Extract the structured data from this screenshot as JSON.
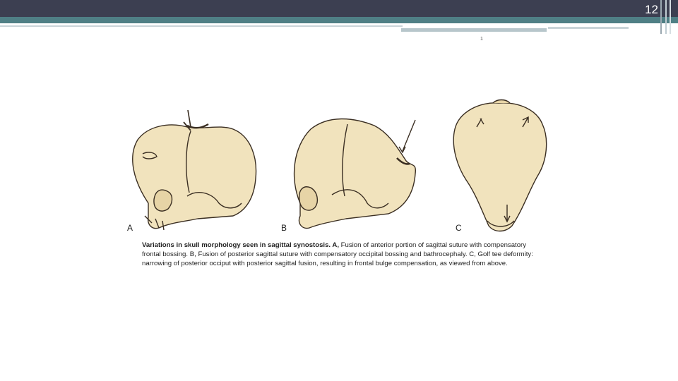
{
  "slide": {
    "number": "12",
    "mark": "1"
  },
  "figure": {
    "labels": {
      "a": "A",
      "b": "B",
      "c": "C"
    },
    "caption": {
      "bold": "Variations in skull morphology seen in sagittal synostosis. A,",
      "text": " Fusion of anterior portion of sagittal suture with compensatory frontal bossing. B, Fusion of posterior sagittal suture with compensatory occipital bossing and bathrocephaly. C, Golf tee deformity: narrowing of posterior occiput with posterior sagittal fusion, resulting in frontal bulge compensation, as viewed from above."
    }
  },
  "colors": {
    "bone": "#f1e3bd",
    "outline": "#3a2e22",
    "header": "#3c3f51",
    "band": "#4f7f85"
  }
}
